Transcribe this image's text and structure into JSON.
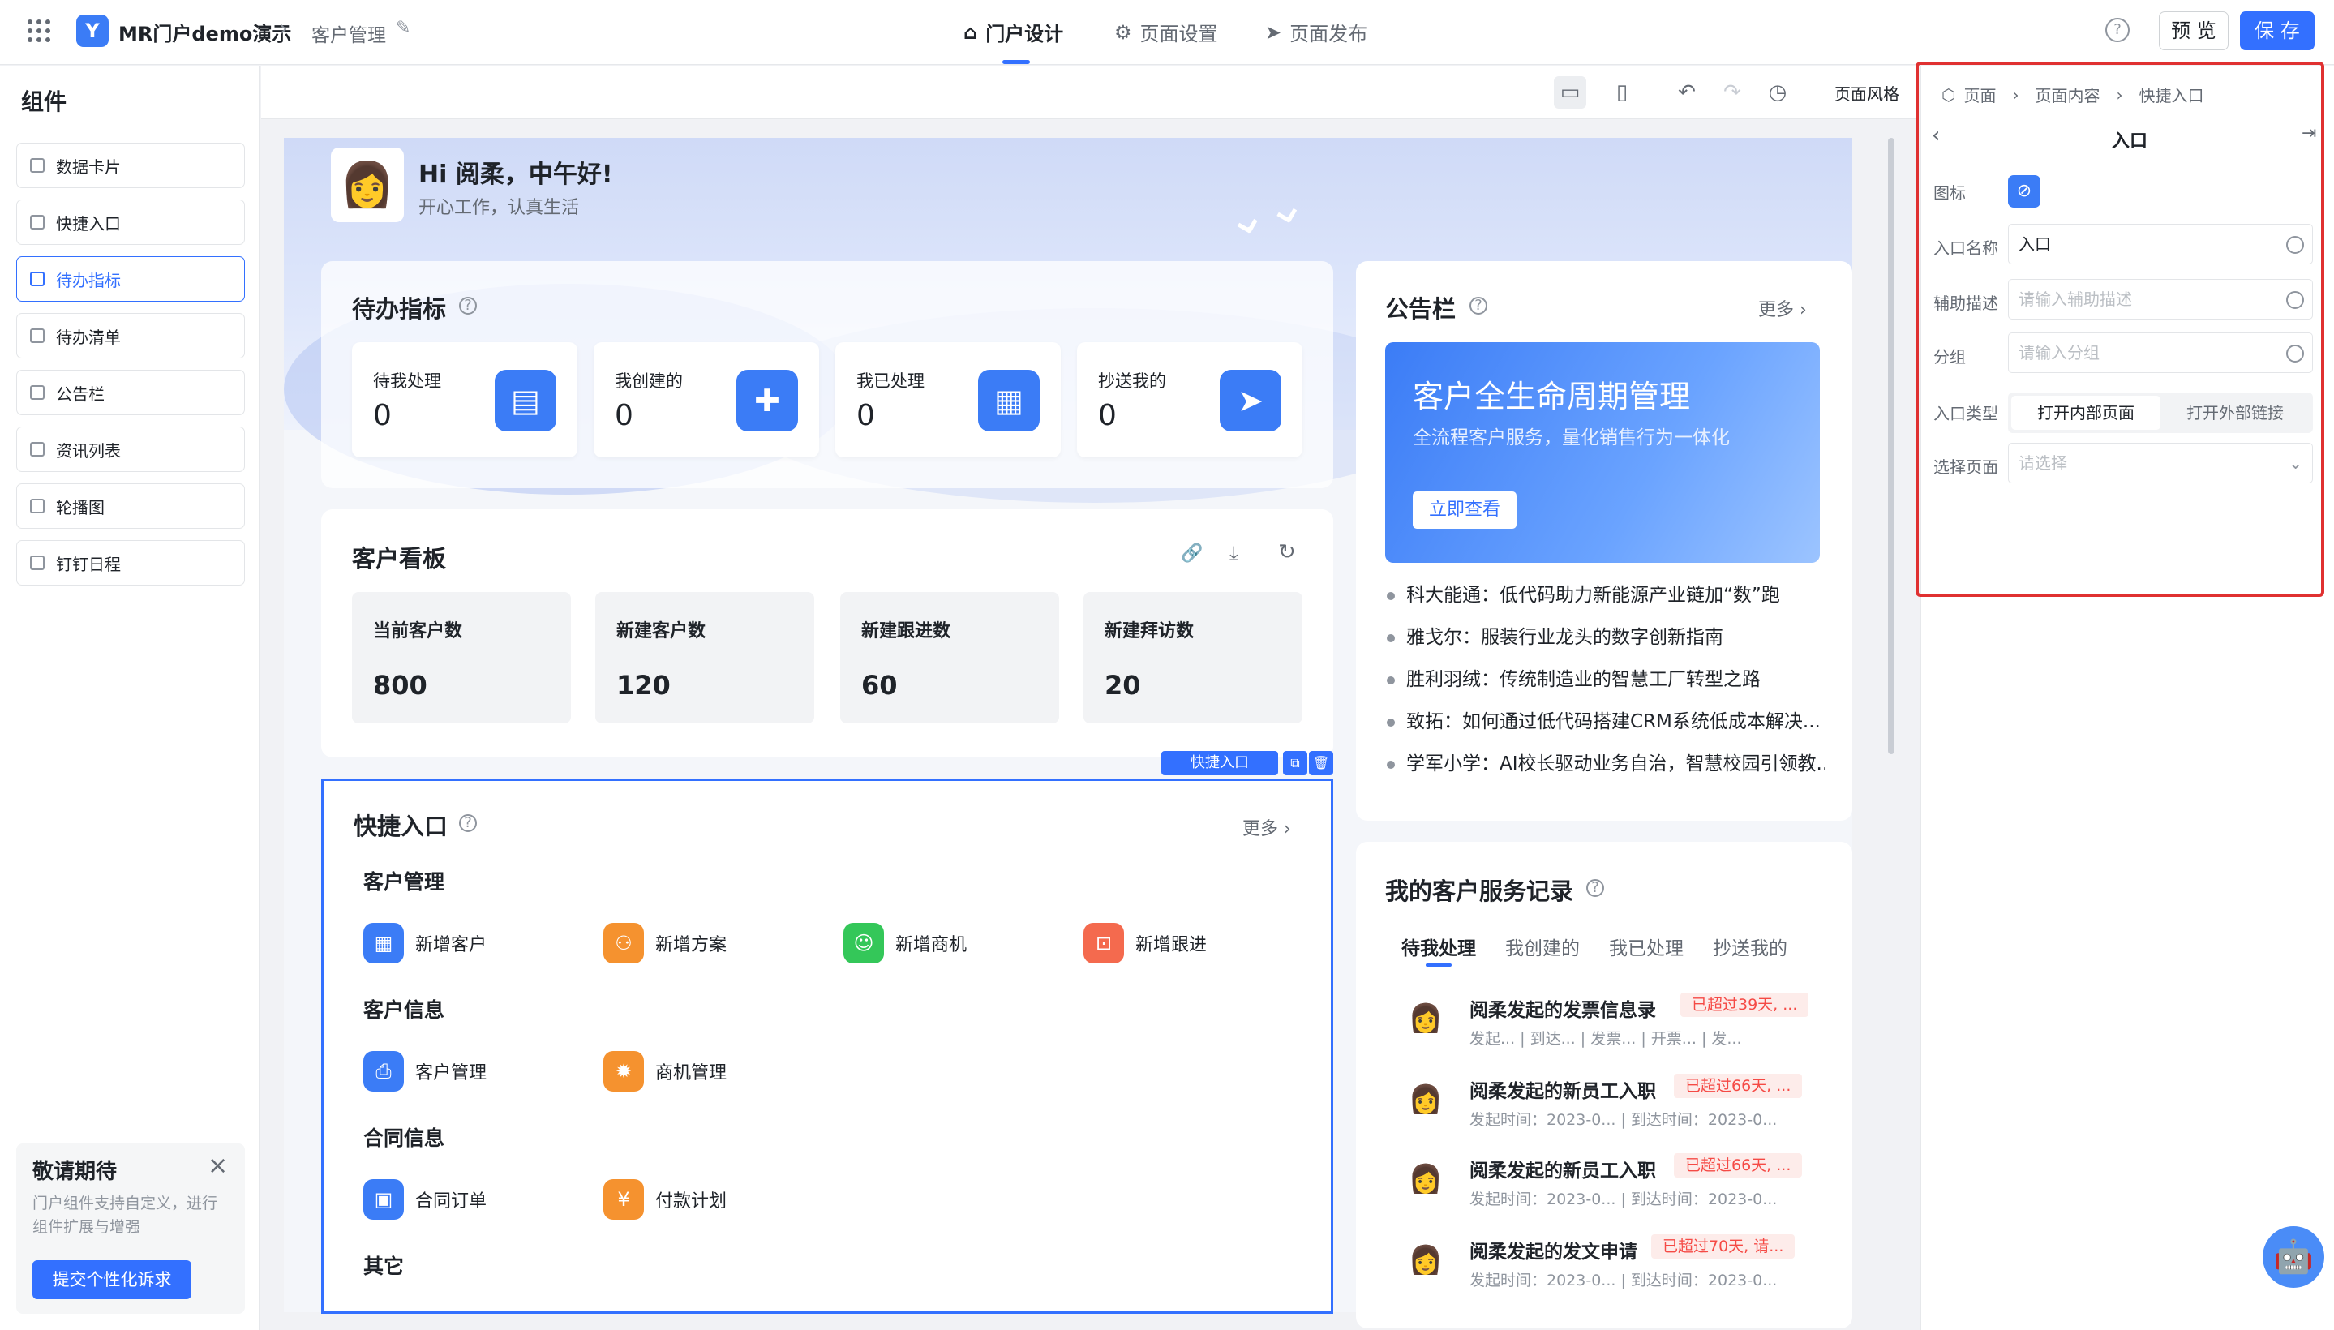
{
  "header": {
    "app_title": "MR门户demo演示",
    "breadcrumb": "客户管理",
    "tabs": [
      {
        "label": "门户设计"
      },
      {
        "label": "页面设置"
      },
      {
        "label": "页面发布"
      }
    ],
    "preview_label": "预 览",
    "save_label": "保 存"
  },
  "left_panel": {
    "title": "组件",
    "items": [
      {
        "label": "数据卡片"
      },
      {
        "label": "快捷入口"
      },
      {
        "label": "待办指标"
      },
      {
        "label": "待办清单"
      },
      {
        "label": "公告栏"
      },
      {
        "label": "资讯列表"
      },
      {
        "label": "轮播图"
      },
      {
        "label": "钉钉日程"
      }
    ],
    "promo": {
      "title": "敬请期待",
      "desc": "门户组件支持自定义，进行组件扩展与增强",
      "button": "提交个性化诉求"
    }
  },
  "toolbar": {
    "style_label": "页面风格"
  },
  "hero": {
    "greeting": "Hi 阅柔，中午好!",
    "subtitle": "开心工作，认真生活"
  },
  "todo": {
    "title": "待办指标",
    "stats": [
      {
        "label": "待我处理",
        "value": "0"
      },
      {
        "label": "我创建的",
        "value": "0"
      },
      {
        "label": "我已处理",
        "value": "0"
      },
      {
        "label": "抄送我的",
        "value": "0"
      }
    ]
  },
  "kanban": {
    "title": "客户看板",
    "stats": [
      {
        "label": "当前客户数",
        "value": "800"
      },
      {
        "label": "新建客户数",
        "value": "120"
      },
      {
        "label": "新建跟进数",
        "value": "60"
      },
      {
        "label": "新建拜访数",
        "value": "20"
      }
    ]
  },
  "quick": {
    "tag": "快捷入口",
    "title": "快捷入口",
    "more": "更多",
    "groups": [
      {
        "name": "客户管理",
        "items": [
          {
            "label": "新增客户",
            "color": "#3b7cf6"
          },
          {
            "label": "新增方案",
            "color": "#f5922f"
          },
          {
            "label": "新增商机",
            "color": "#34c759"
          },
          {
            "label": "新增跟进",
            "color": "#f46a4e"
          }
        ]
      },
      {
        "name": "客户信息",
        "items": [
          {
            "label": "客户管理",
            "color": "#3b7cf6"
          },
          {
            "label": "商机管理",
            "color": "#f5922f"
          }
        ]
      },
      {
        "name": "合同信息",
        "items": [
          {
            "label": "合同订单",
            "color": "#3b7cf6"
          },
          {
            "label": "付款计划",
            "color": "#f5922f"
          }
        ]
      },
      {
        "name": "其它",
        "items": []
      }
    ]
  },
  "notice": {
    "title": "公告栏",
    "more": "更多",
    "banner_title": "客户全生命周期管理",
    "banner_sub": "全流程客户服务，量化销售行为一体化",
    "banner_btn": "立即查看",
    "items": [
      "科大能通：低代码助力新能源产业链加“数”跑",
      "雅戈尔：服装行业龙头的数字创新指南",
      "胜利羽绒：传统制造业的智慧工厂转型之路",
      "致拓：如何通过低代码搭建CRM系统低成本解决...",
      "学军小学：AI校长驱动业务自治，智慧校园引领教..."
    ]
  },
  "service": {
    "title": "我的客户服务记录",
    "tabs": [
      "待我处理",
      "我创建的",
      "我已处理",
      "抄送我的"
    ],
    "records": [
      {
        "title": "阅柔发起的发票信息录",
        "badge": "已超过39天, ...",
        "meta": "发起...  | 到达...  | 发票...  | 开票...  | 发..."
      },
      {
        "title": "阅柔发起的新员工入职",
        "badge": "已超过66天, ...",
        "meta": "发起时间：2023-0...  | 到达时间：2023-0..."
      },
      {
        "title": "阅柔发起的新员工入职",
        "badge": "已超过66天, ...",
        "meta": "发起时间：2023-0...  | 到达时间：2023-0..."
      },
      {
        "title": "阅柔发起的发文申请",
        "badge": "已超过70天, 请...",
        "meta": "发起时间：2023-0...  | 到达时间：2023-0..."
      }
    ]
  },
  "right_panel": {
    "crumbs": [
      "页面",
      "页面内容",
      "快捷入口"
    ],
    "title": "入口",
    "fields": {
      "icon_label": "图标",
      "name_label": "入口名称",
      "name_value": "入口",
      "desc_label": "辅助描述",
      "desc_placeholder": "请输入辅助描述",
      "group_label": "分组",
      "group_placeholder": "请输入分组",
      "type_label": "入口类型",
      "type_options": [
        "打开内部页面",
        "打开外部链接"
      ],
      "page_label": "选择页面",
      "page_placeholder": "请选择"
    }
  }
}
